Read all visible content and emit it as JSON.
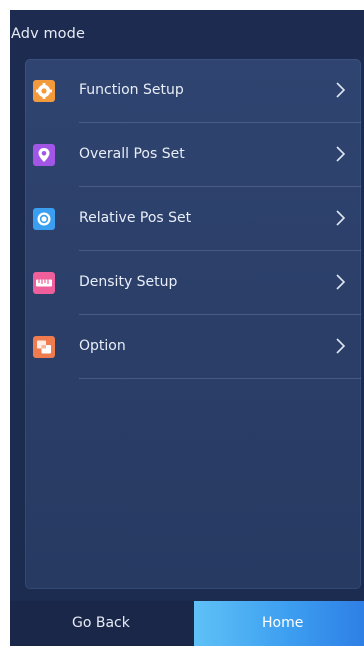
{
  "header": {
    "title": "Adv mode"
  },
  "menu": {
    "items": [
      {
        "label": "Function Setup",
        "icon": "gear-icon",
        "icon_color": "#f39a3c"
      },
      {
        "label": "Overall Pos Set",
        "icon": "location-pin-icon",
        "icon_color": "#a256e6"
      },
      {
        "label": "Relative Pos Set",
        "icon": "target-icon",
        "icon_color": "#3a9ff0"
      },
      {
        "label": "Density Setup",
        "icon": "ruler-icon",
        "icon_color": "#ee5f9b"
      },
      {
        "label": "Option",
        "icon": "layers-icon",
        "icon_color": "#f07b4f"
      }
    ],
    "chevron": ">"
  },
  "footer": {
    "back_label": "Go Back",
    "home_label": "Home"
  },
  "colors": {
    "background": "#1c2b50",
    "panel": "#2b3f69",
    "accent": "#3d9ff0"
  }
}
